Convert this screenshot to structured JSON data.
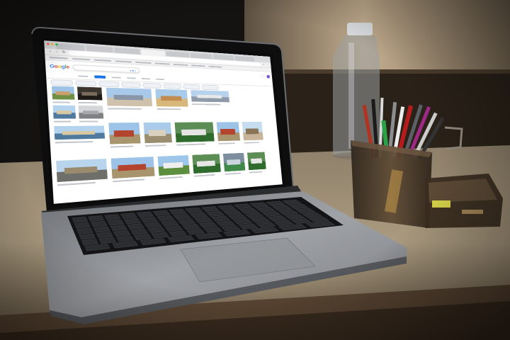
{
  "scene": {
    "subject": "laptop on a desk beside a pen holder",
    "colors": {
      "background_wall": "#e6d2b4",
      "dark_panel": "#1c1b19",
      "desk": "#c4b294",
      "laptop_body": "#9c9fa3",
      "keyboard": "#19191b",
      "pen_holder": "#4b3a28",
      "bottle": "#b6bcbf"
    }
  },
  "screen": {
    "logo": "Google",
    "search": {
      "icons": [
        "microphone-icon",
        "camera-icon",
        "search-icon"
      ]
    },
    "colors": {
      "accent": "#1a73e8",
      "avatar": "#7b58d6",
      "logo": [
        "#4285f4",
        "#ea4335",
        "#fbbc05",
        "#4285f4",
        "#34a853",
        "#ea4335"
      ]
    },
    "result_image_themes": [
      "sky-grass",
      "dark-interior",
      "plaza",
      "desert",
      "modern-building",
      "coast",
      "red-building",
      "village",
      "green-field",
      "red-building",
      "clock-tower",
      "road",
      "red-building",
      "lawn",
      "green-field",
      "sports-court",
      "coast",
      "grey-street",
      "village",
      "green-field"
    ]
  }
}
